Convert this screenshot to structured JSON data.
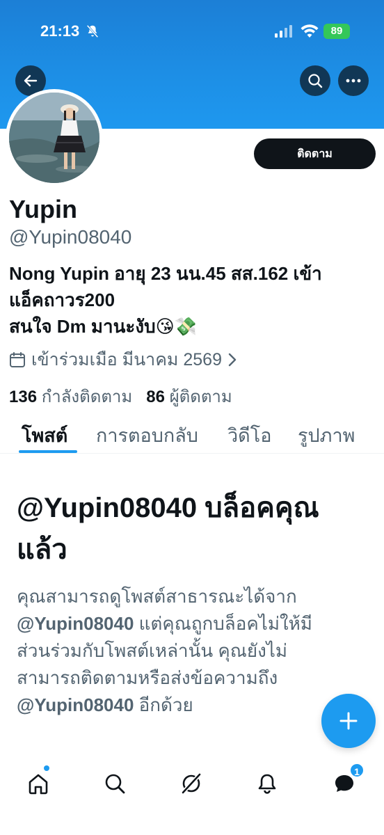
{
  "status_bar": {
    "time": "21:13",
    "battery": "89"
  },
  "profile": {
    "follow_label": "ติดตาม",
    "display_name": "Yupin",
    "handle": "@Yupin08040",
    "bio_lines": [
      "Nong Yupin อายุ 23 นน.45 สส.162 เข้า",
      "แอ็คถาวร200",
      "สนใจ Dm มานะงับ😘💸"
    ],
    "joined": "เข้าร่วมเมือ มีนาคม 2569",
    "following_count": "136",
    "following_label": "กำลังติดตาม",
    "followers_count": "86",
    "followers_label": "ผู้ติดตาม"
  },
  "tabs": [
    {
      "label": "โพสต์"
    },
    {
      "label": "การตอบกลับ"
    },
    {
      "label": "วิดีโอ"
    },
    {
      "label": "รูปภาพ"
    }
  ],
  "blocked": {
    "title_line1": "@Yupin08040 บล็อคคุณ",
    "title_line2": "แล้ว",
    "desc_line1": "คุณสามารถดูโพสต์สาธารณะได้จาก",
    "desc_handle1": "@Yupin08040",
    "desc_line2_rest": " แต่คุณถูกบล็อคไม่ให้มี",
    "desc_line3": "ส่วนร่วมกับโพสต์เหล่านั้น คุณยังไม่",
    "desc_line4": "สามารถติดตามหรือส่งข้อความถึง",
    "desc_handle2": "@Yupin08040",
    "desc_line5_rest": " อีกด้วย"
  },
  "nav": {
    "messages_badge": "1"
  },
  "colors": {
    "accent": "#1d9bf0",
    "banner": "#1d8fe6",
    "text": "#0f1419",
    "muted": "#536471"
  },
  "icons": [
    "back-arrow-icon",
    "search-icon",
    "more-icon",
    "calendar-icon",
    "chevron-right-icon",
    "plus-icon",
    "home-icon",
    "grok-icon",
    "bell-icon",
    "messages-icon"
  ]
}
